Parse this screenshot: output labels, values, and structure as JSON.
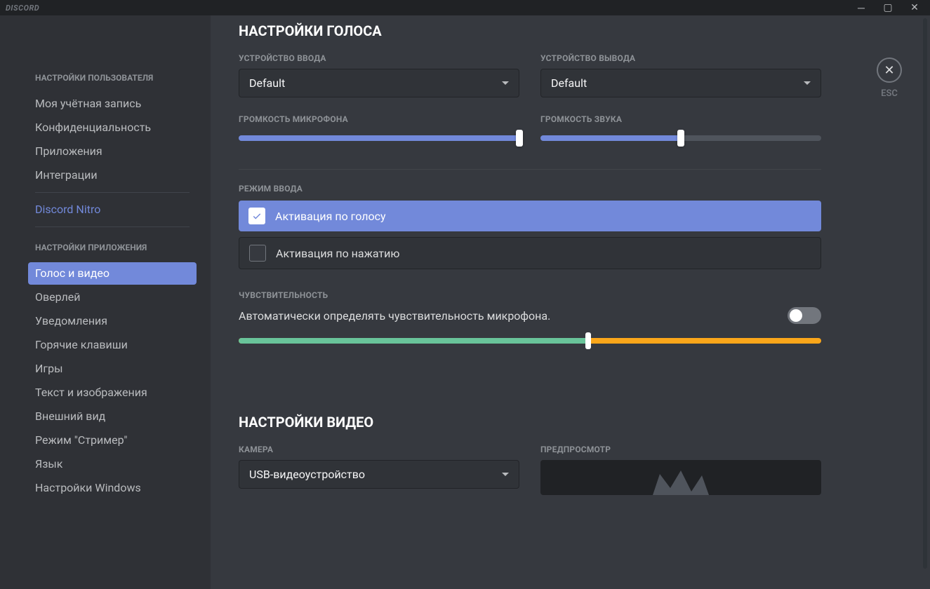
{
  "titlebar": {
    "logo": "DISCORD"
  },
  "close": {
    "label": "ESC"
  },
  "sidebar": {
    "header_user": "НАСТРОЙКИ ПОЛЬЗОВАТЕЛЯ",
    "items_user": [
      "Моя учётная запись",
      "Конфиденциальность",
      "Приложения",
      "Интеграции"
    ],
    "nitro": "Discord Nitro",
    "header_app": "НАСТРОЙКИ ПРИЛОЖЕНИЯ",
    "items_app": [
      "Голос и видео",
      "Оверлей",
      "Уведомления",
      "Горячие клавиши",
      "Игры",
      "Текст и изображения",
      "Внешний вид",
      "Режим \"Стример\"",
      "Язык",
      "Настройки Windows"
    ]
  },
  "voice": {
    "title": "НАСТРОЙКИ ГОЛОСА",
    "input_device_label": "УСТРОЙСТВО ВВОДА",
    "input_device_value": "Default",
    "output_device_label": "УСТРОЙСТВО ВЫВОДА",
    "output_device_value": "Default",
    "mic_volume_label": "ГРОМКОСТЬ МИКРОФОНА",
    "mic_volume_pct": 100,
    "sound_volume_label": "ГРОМКОСТЬ ЗВУКА",
    "sound_volume_pct": 50,
    "input_mode_label": "РЕЖИМ ВВОДА",
    "input_mode_voice": "Активация по голосу",
    "input_mode_push": "Активация по нажатию",
    "sensitivity_label": "ЧУВСТВИТЕЛЬНОСТЬ",
    "sensitivity_auto_text": "Автоматически определять чувствительность микрофона.",
    "sensitivity_auto_on": false,
    "sensitivity_pct": 60
  },
  "video": {
    "title": "НАСТРОЙКИ ВИДЕО",
    "camera_label": "КАМЕРА",
    "camera_value": "USB-видеоустройство",
    "preview_label": "ПРЕДПРОСМОТР"
  }
}
